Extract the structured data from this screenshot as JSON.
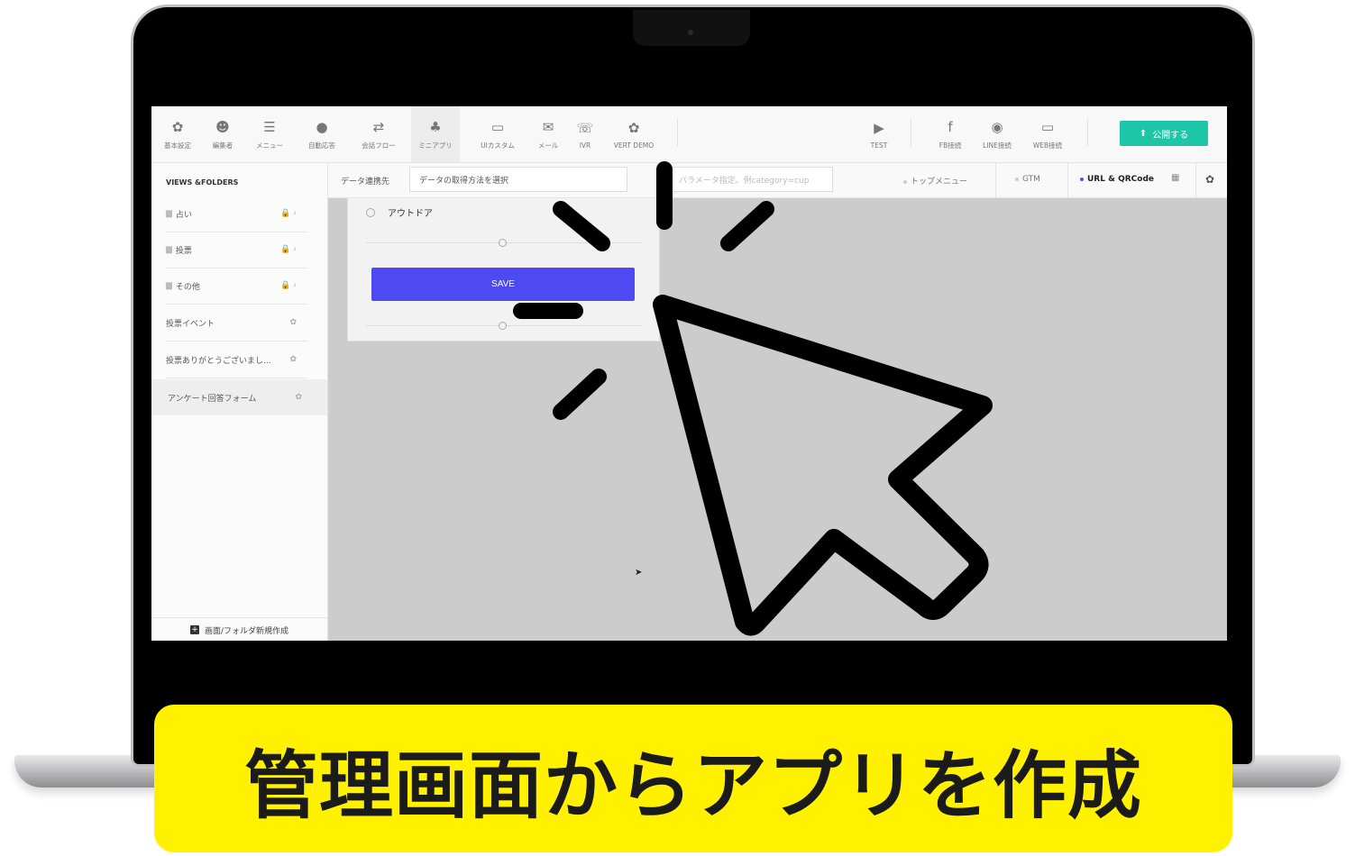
{
  "toolbar": {
    "items": [
      {
        "icon": "gear-icon",
        "glyph": "✿",
        "label": "基本設定"
      },
      {
        "icon": "users-icon",
        "glyph": "☻",
        "label": "編集者"
      },
      {
        "icon": "list-icon",
        "glyph": "☰",
        "label": "メニュー"
      },
      {
        "icon": "chat-icon",
        "glyph": "●",
        "label": "自動応答"
      },
      {
        "icon": "shuffle-icon",
        "glyph": "⇄",
        "label": "会話フロー"
      },
      {
        "icon": "puzzle-icon",
        "glyph": "♣",
        "label": "ミニアプリ"
      },
      {
        "icon": "monitor-icon",
        "glyph": "▭",
        "label": "UIカスタム"
      },
      {
        "icon": "mail-icon",
        "glyph": "✉",
        "label": "メール"
      },
      {
        "icon": "phone-icon",
        "glyph": "☏",
        "label": "IVR"
      },
      {
        "icon": "gear-icon",
        "glyph": "✿",
        "label": "VERT DEMO"
      }
    ],
    "right_items": [
      {
        "icon": "play-icon",
        "glyph": "▶",
        "label": "TEST"
      },
      {
        "icon": "facebook-icon",
        "glyph": "f",
        "label": "FB接続"
      },
      {
        "icon": "line-icon",
        "glyph": "◉",
        "label": "LINE接続"
      },
      {
        "icon": "window-icon",
        "glyph": "▭",
        "label": "WEB接続"
      }
    ],
    "publish_label": "公開する",
    "publish_icon": "upload-icon"
  },
  "sidebar": {
    "heading": "VIEWS &FOLDERS",
    "items": [
      {
        "label": "占い",
        "folder": true,
        "right": "🔒 ›"
      },
      {
        "label": "投票",
        "folder": true,
        "right": "🔒 ›"
      },
      {
        "label": "その他",
        "folder": true,
        "right": "🔒 ›"
      },
      {
        "label": "投票イベント",
        "folder": false,
        "right": "✿"
      },
      {
        "label": "投票ありがとうございまし...",
        "folder": false,
        "right": "✿"
      },
      {
        "label": "アンケート回答フォーム",
        "folder": false,
        "right": "✿"
      }
    ],
    "footer_label": "画面/フォルダ新規作成"
  },
  "databar": {
    "label": "データ連携先",
    "select_value": "データの取得方法を選択",
    "param_placeholder": "パラメータ指定。例category=cup",
    "tabs": [
      "トップメニュー",
      "GTM",
      "URL & QRCode"
    ]
  },
  "form": {
    "option_label": "アウトドア",
    "save_label": "SAVE"
  },
  "caption": "管理画面からアプリを作成",
  "colors": {
    "accent": "#4e4af2",
    "publish": "#1cc6a6",
    "caption_bg": "#fff100"
  }
}
